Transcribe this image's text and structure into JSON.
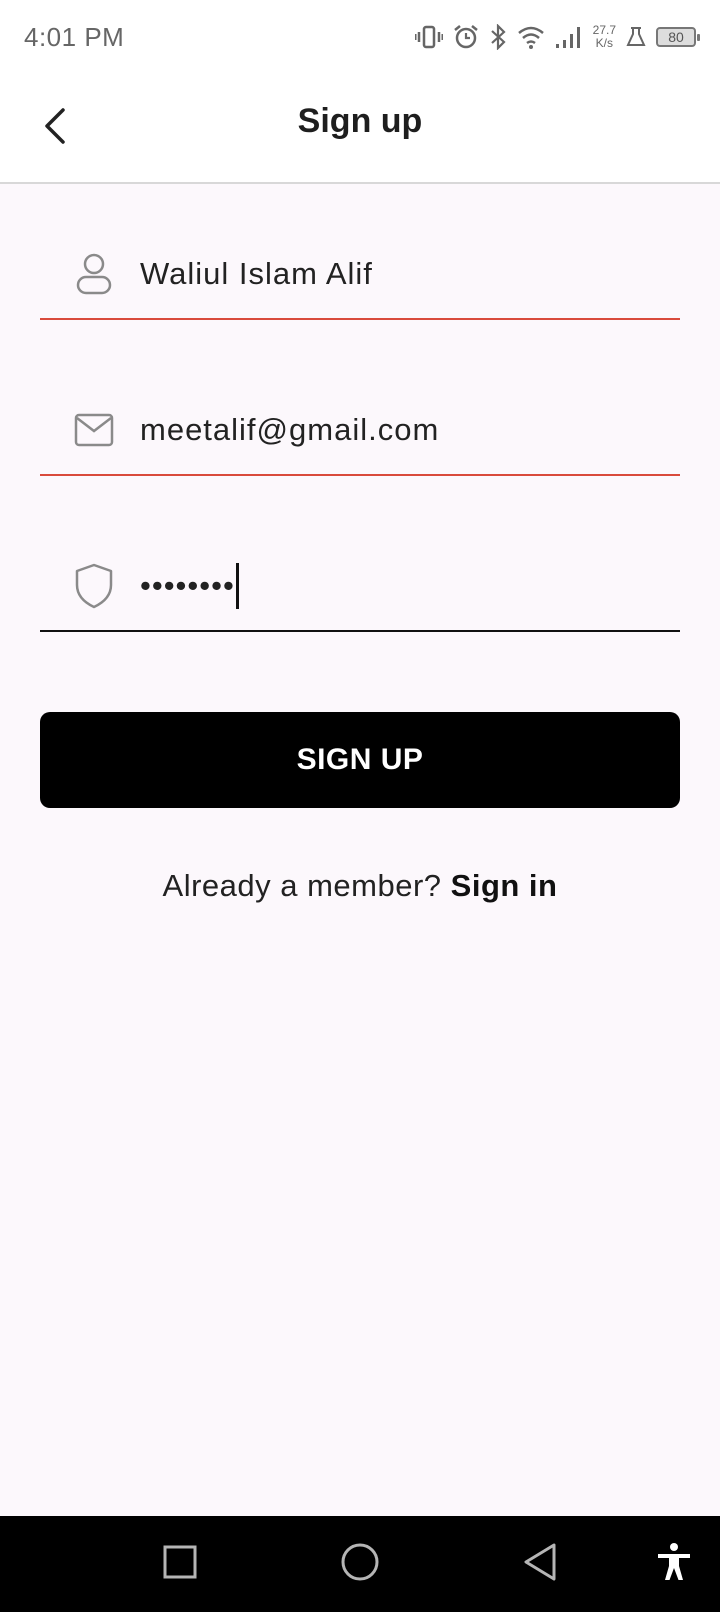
{
  "status_bar": {
    "time": "4:01 PM",
    "net_speed_value": "27.7",
    "net_speed_unit": "K/s",
    "battery": "80",
    "icons": [
      "vibrate-icon",
      "alarm-icon",
      "bluetooth-icon",
      "wifi-icon",
      "signal-icon",
      "lab-icon",
      "battery-icon"
    ]
  },
  "app_bar": {
    "title": "Sign up",
    "back_icon": "chevron-left-icon"
  },
  "form": {
    "name": {
      "value": "Waliul Islam Alif",
      "icon": "user-icon"
    },
    "email": {
      "value": "meetalif@gmail.com",
      "icon": "mail-icon"
    },
    "password": {
      "value": "••••••••",
      "icon": "shield-icon"
    },
    "underline_error_color": "#d94b3c",
    "underline_active_color": "#111111"
  },
  "signup_button": {
    "label": "SIGN UP"
  },
  "signin": {
    "prompt": "Already a member?",
    "link": "Sign in"
  },
  "nav_bar": {
    "icons": [
      "recents-square-icon",
      "home-circle-icon",
      "back-triangle-icon",
      "accessibility-icon"
    ]
  }
}
